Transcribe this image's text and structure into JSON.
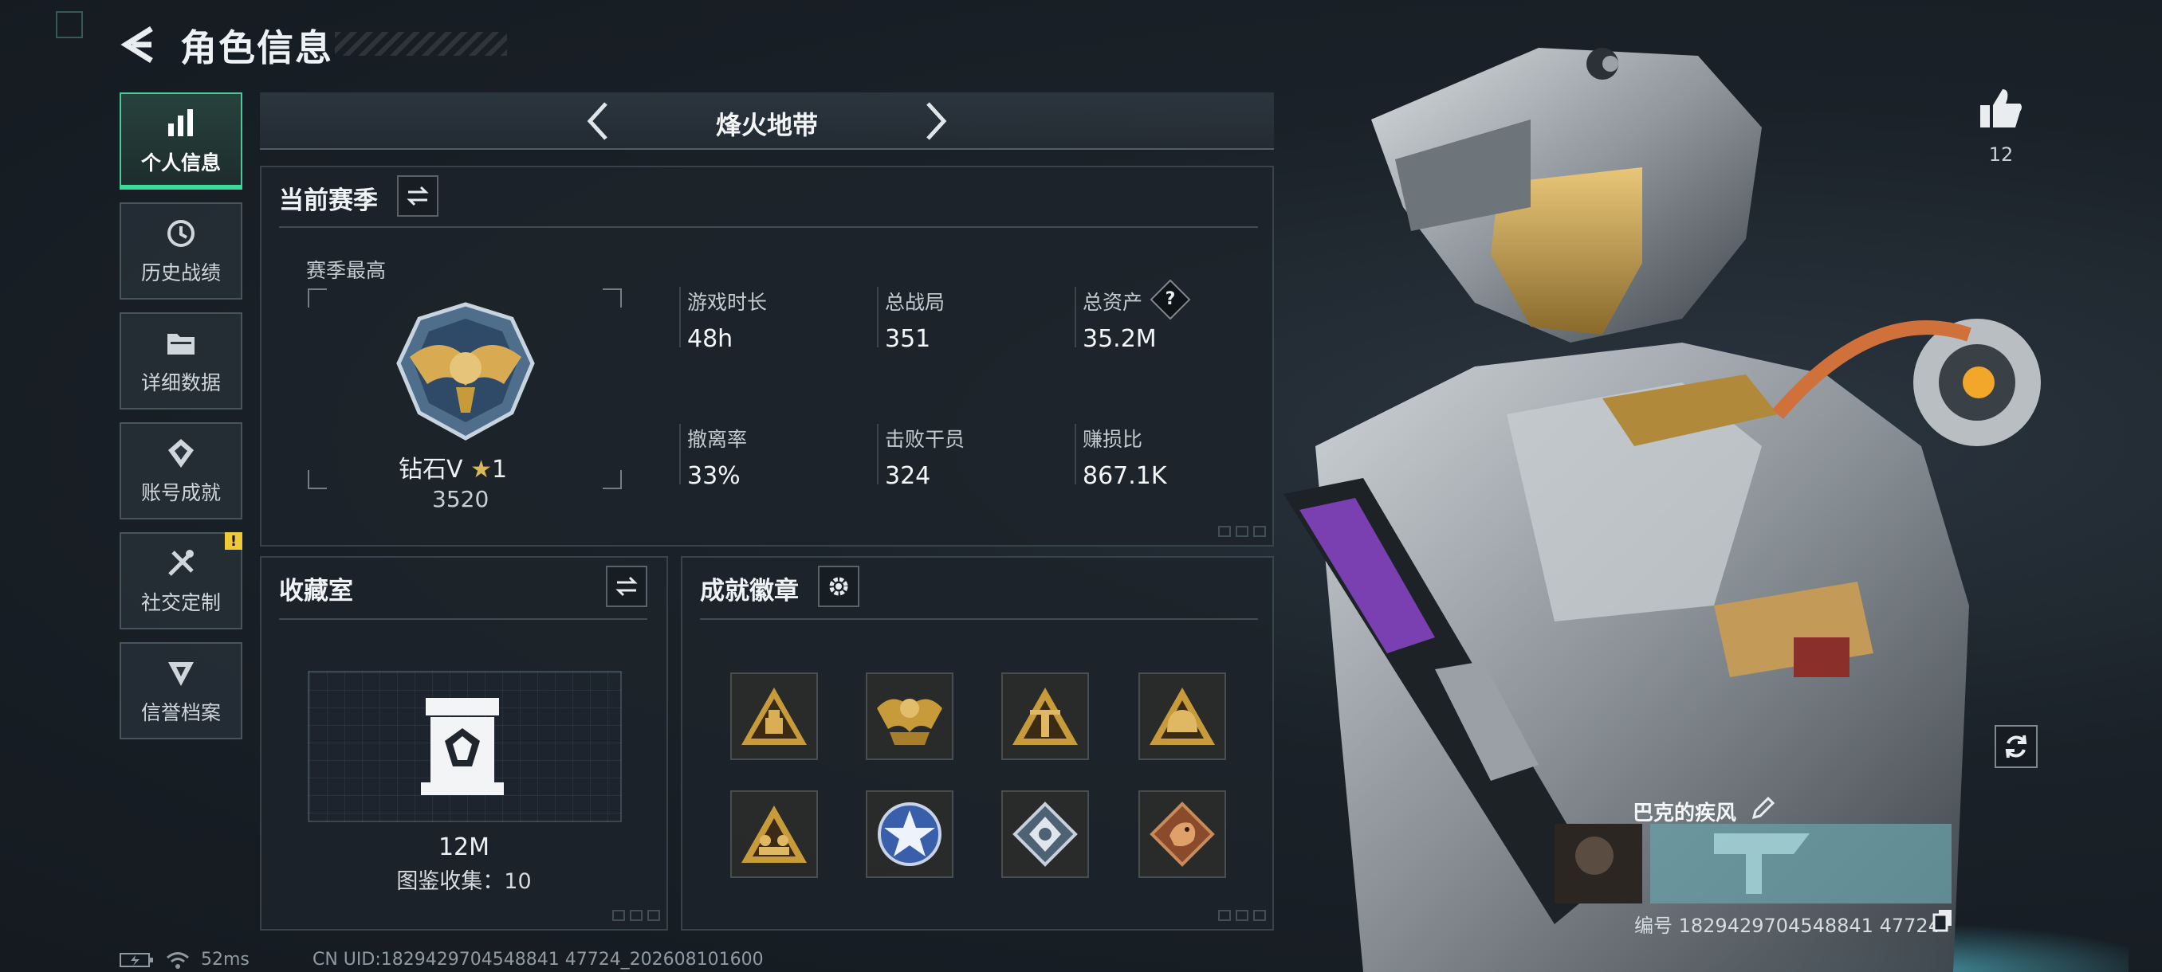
{
  "header": {
    "title": "角色信息"
  },
  "sidebar": {
    "items": [
      {
        "label": "个人信息",
        "icon": "bar-chart-icon",
        "active": true
      },
      {
        "label": "历史战绩",
        "icon": "history-icon"
      },
      {
        "label": "详细数据",
        "icon": "folder-icon"
      },
      {
        "label": "账号成就",
        "icon": "achievement-icon"
      },
      {
        "label": "社交定制",
        "icon": "tools-icon",
        "badge": "!"
      },
      {
        "label": "信誉档案",
        "icon": "credit-icon"
      }
    ]
  },
  "mode": {
    "name": "烽火地带"
  },
  "season": {
    "title": "当前赛季",
    "best_label": "赛季最高",
    "rank_name": "钻石V",
    "rank_stars": "1",
    "rank_score": "3520",
    "stats": [
      {
        "label": "游戏时长",
        "value": "48h"
      },
      {
        "label": "总战局",
        "value": "351"
      },
      {
        "label": "总资产",
        "value": "35.2M",
        "help": "?"
      },
      {
        "label": "撤离率",
        "value": "33%"
      },
      {
        "label": "击败干员",
        "value": "324"
      },
      {
        "label": "赚损比",
        "value": "867.1K"
      }
    ]
  },
  "collection": {
    "title": "收藏室",
    "value": "12M",
    "count_text": "图鉴收集：10"
  },
  "achievements": {
    "title": "成就徽章",
    "medals": [
      "medal-supply-icon",
      "medal-eagle-icon",
      "medal-tower-icon",
      "medal-helmet-icon",
      "medal-squad-icon",
      "medal-star-icon",
      "medal-diamond-icon",
      "medal-dragon-icon"
    ]
  },
  "character": {
    "likes": "12",
    "player_name": "巴克的疾风",
    "player_id": "编号 1829429704548841 47724"
  },
  "status": {
    "ping": "52ms",
    "uid": "CN UID:1829429704548841 47724_202608101600"
  },
  "colors": {
    "accent": "#3fd79a",
    "gold": "#c79a3a",
    "warn": "#f0c93a"
  }
}
